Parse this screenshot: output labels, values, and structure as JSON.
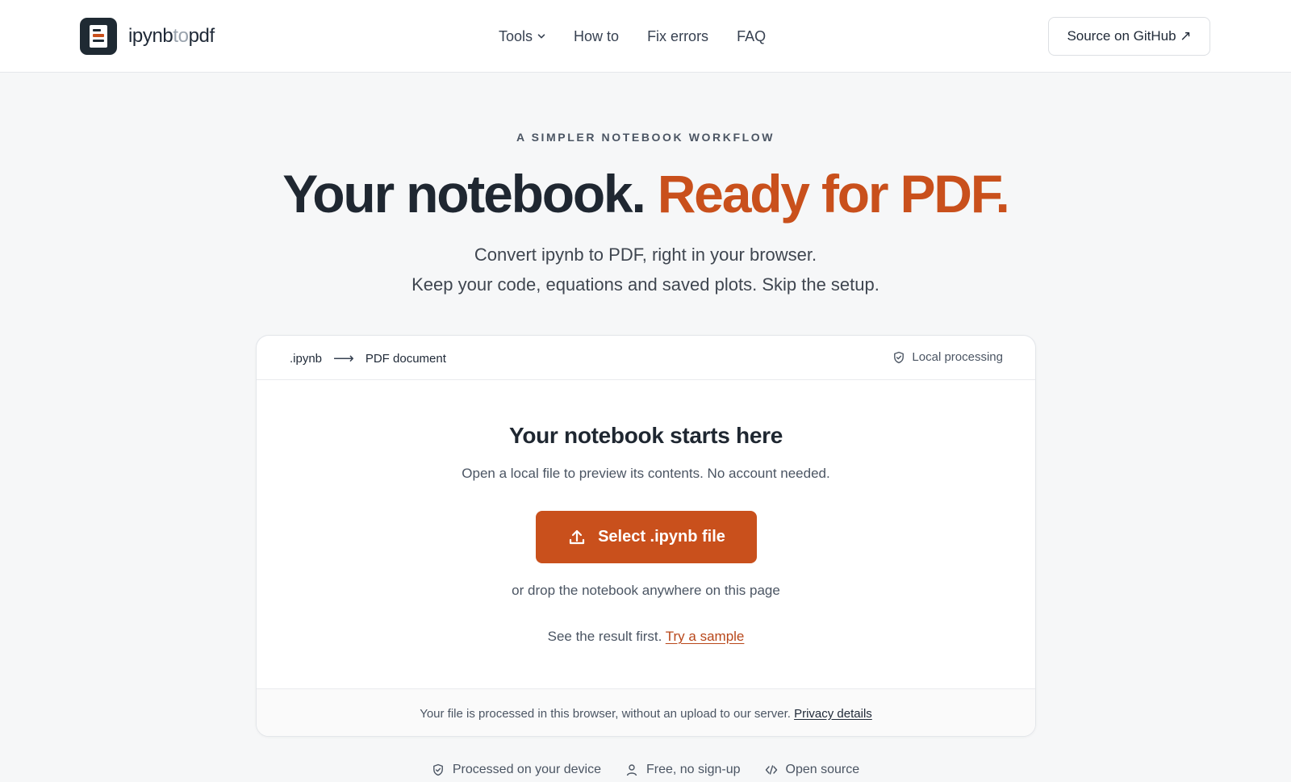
{
  "brand": {
    "name_part1": "ipynb",
    "name_part2": "to",
    "name_part3": "pdf"
  },
  "nav": {
    "items": [
      {
        "label": "Tools",
        "dropdown": true
      },
      {
        "label": "How to"
      },
      {
        "label": "Fix errors"
      },
      {
        "label": "FAQ"
      }
    ]
  },
  "github_button": {
    "label": "Source on GitHub ↗"
  },
  "hero": {
    "eyebrow": "A SIMPLER NOTEBOOK WORKFLOW",
    "headline_part1": "Your notebook.",
    "headline_part2": "Ready for PDF.",
    "sub_line1": "Convert ipynb to PDF, right in your browser.",
    "sub_line2": "Keep your code, equations and saved plots. Skip the setup."
  },
  "card": {
    "flow_from": ".ipynb",
    "flow_arrow": "⟶",
    "flow_to": "PDF document",
    "local_badge": "Local processing",
    "title": "Your notebook starts here",
    "description": "Open a local file to preview its contents. No account needed.",
    "select_button": "Select .ipynb file",
    "drop_hint": "or drop the notebook anywhere on this page",
    "sample_prefix": "See the result first.",
    "sample_link": "Try a sample",
    "footer_text": "Your file is processed in this browser, without an upload to our server.",
    "privacy_link": "Privacy details"
  },
  "features": [
    {
      "label": "Processed on your device",
      "icon": "shield-icon"
    },
    {
      "label": "Free, no sign-up",
      "icon": "user-icon"
    },
    {
      "label": "Open source",
      "icon": "code-icon"
    }
  ],
  "colors": {
    "accent": "#c9501c",
    "dark": "#1f2731",
    "bg": "#f6f7f8"
  }
}
